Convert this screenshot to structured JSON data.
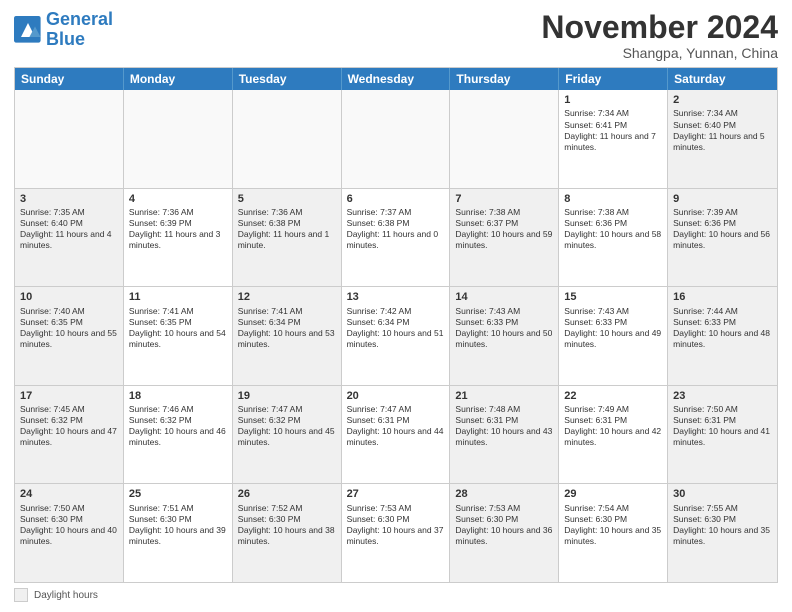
{
  "logo": {
    "line1": "General",
    "line2": "Blue"
  },
  "title": "November 2024",
  "location": "Shangpa, Yunnan, China",
  "days_of_week": [
    "Sunday",
    "Monday",
    "Tuesday",
    "Wednesday",
    "Thursday",
    "Friday",
    "Saturday"
  ],
  "footer_label": "Daylight hours",
  "weeks": [
    [
      {
        "day": "",
        "empty": true
      },
      {
        "day": "",
        "empty": true
      },
      {
        "day": "",
        "empty": true
      },
      {
        "day": "",
        "empty": true
      },
      {
        "day": "",
        "empty": true
      },
      {
        "day": "1",
        "sunrise": "Sunrise: 7:34 AM",
        "sunset": "Sunset: 6:41 PM",
        "daylight": "Daylight: 11 hours and 7 minutes."
      },
      {
        "day": "2",
        "sunrise": "Sunrise: 7:34 AM",
        "sunset": "Sunset: 6:40 PM",
        "daylight": "Daylight: 11 hours and 5 minutes."
      }
    ],
    [
      {
        "day": "3",
        "sunrise": "Sunrise: 7:35 AM",
        "sunset": "Sunset: 6:40 PM",
        "daylight": "Daylight: 11 hours and 4 minutes."
      },
      {
        "day": "4",
        "sunrise": "Sunrise: 7:36 AM",
        "sunset": "Sunset: 6:39 PM",
        "daylight": "Daylight: 11 hours and 3 minutes."
      },
      {
        "day": "5",
        "sunrise": "Sunrise: 7:36 AM",
        "sunset": "Sunset: 6:38 PM",
        "daylight": "Daylight: 11 hours and 1 minute."
      },
      {
        "day": "6",
        "sunrise": "Sunrise: 7:37 AM",
        "sunset": "Sunset: 6:38 PM",
        "daylight": "Daylight: 11 hours and 0 minutes."
      },
      {
        "day": "7",
        "sunrise": "Sunrise: 7:38 AM",
        "sunset": "Sunset: 6:37 PM",
        "daylight": "Daylight: 10 hours and 59 minutes."
      },
      {
        "day": "8",
        "sunrise": "Sunrise: 7:38 AM",
        "sunset": "Sunset: 6:36 PM",
        "daylight": "Daylight: 10 hours and 58 minutes."
      },
      {
        "day": "9",
        "sunrise": "Sunrise: 7:39 AM",
        "sunset": "Sunset: 6:36 PM",
        "daylight": "Daylight: 10 hours and 56 minutes."
      }
    ],
    [
      {
        "day": "10",
        "sunrise": "Sunrise: 7:40 AM",
        "sunset": "Sunset: 6:35 PM",
        "daylight": "Daylight: 10 hours and 55 minutes."
      },
      {
        "day": "11",
        "sunrise": "Sunrise: 7:41 AM",
        "sunset": "Sunset: 6:35 PM",
        "daylight": "Daylight: 10 hours and 54 minutes."
      },
      {
        "day": "12",
        "sunrise": "Sunrise: 7:41 AM",
        "sunset": "Sunset: 6:34 PM",
        "daylight": "Daylight: 10 hours and 53 minutes."
      },
      {
        "day": "13",
        "sunrise": "Sunrise: 7:42 AM",
        "sunset": "Sunset: 6:34 PM",
        "daylight": "Daylight: 10 hours and 51 minutes."
      },
      {
        "day": "14",
        "sunrise": "Sunrise: 7:43 AM",
        "sunset": "Sunset: 6:33 PM",
        "daylight": "Daylight: 10 hours and 50 minutes."
      },
      {
        "day": "15",
        "sunrise": "Sunrise: 7:43 AM",
        "sunset": "Sunset: 6:33 PM",
        "daylight": "Daylight: 10 hours and 49 minutes."
      },
      {
        "day": "16",
        "sunrise": "Sunrise: 7:44 AM",
        "sunset": "Sunset: 6:33 PM",
        "daylight": "Daylight: 10 hours and 48 minutes."
      }
    ],
    [
      {
        "day": "17",
        "sunrise": "Sunrise: 7:45 AM",
        "sunset": "Sunset: 6:32 PM",
        "daylight": "Daylight: 10 hours and 47 minutes."
      },
      {
        "day": "18",
        "sunrise": "Sunrise: 7:46 AM",
        "sunset": "Sunset: 6:32 PM",
        "daylight": "Daylight: 10 hours and 46 minutes."
      },
      {
        "day": "19",
        "sunrise": "Sunrise: 7:47 AM",
        "sunset": "Sunset: 6:32 PM",
        "daylight": "Daylight: 10 hours and 45 minutes."
      },
      {
        "day": "20",
        "sunrise": "Sunrise: 7:47 AM",
        "sunset": "Sunset: 6:31 PM",
        "daylight": "Daylight: 10 hours and 44 minutes."
      },
      {
        "day": "21",
        "sunrise": "Sunrise: 7:48 AM",
        "sunset": "Sunset: 6:31 PM",
        "daylight": "Daylight: 10 hours and 43 minutes."
      },
      {
        "day": "22",
        "sunrise": "Sunrise: 7:49 AM",
        "sunset": "Sunset: 6:31 PM",
        "daylight": "Daylight: 10 hours and 42 minutes."
      },
      {
        "day": "23",
        "sunrise": "Sunrise: 7:50 AM",
        "sunset": "Sunset: 6:31 PM",
        "daylight": "Daylight: 10 hours and 41 minutes."
      }
    ],
    [
      {
        "day": "24",
        "sunrise": "Sunrise: 7:50 AM",
        "sunset": "Sunset: 6:30 PM",
        "daylight": "Daylight: 10 hours and 40 minutes."
      },
      {
        "day": "25",
        "sunrise": "Sunrise: 7:51 AM",
        "sunset": "Sunset: 6:30 PM",
        "daylight": "Daylight: 10 hours and 39 minutes."
      },
      {
        "day": "26",
        "sunrise": "Sunrise: 7:52 AM",
        "sunset": "Sunset: 6:30 PM",
        "daylight": "Daylight: 10 hours and 38 minutes."
      },
      {
        "day": "27",
        "sunrise": "Sunrise: 7:53 AM",
        "sunset": "Sunset: 6:30 PM",
        "daylight": "Daylight: 10 hours and 37 minutes."
      },
      {
        "day": "28",
        "sunrise": "Sunrise: 7:53 AM",
        "sunset": "Sunset: 6:30 PM",
        "daylight": "Daylight: 10 hours and 36 minutes."
      },
      {
        "day": "29",
        "sunrise": "Sunrise: 7:54 AM",
        "sunset": "Sunset: 6:30 PM",
        "daylight": "Daylight: 10 hours and 35 minutes."
      },
      {
        "day": "30",
        "sunrise": "Sunrise: 7:55 AM",
        "sunset": "Sunset: 6:30 PM",
        "daylight": "Daylight: 10 hours and 35 minutes."
      }
    ]
  ]
}
